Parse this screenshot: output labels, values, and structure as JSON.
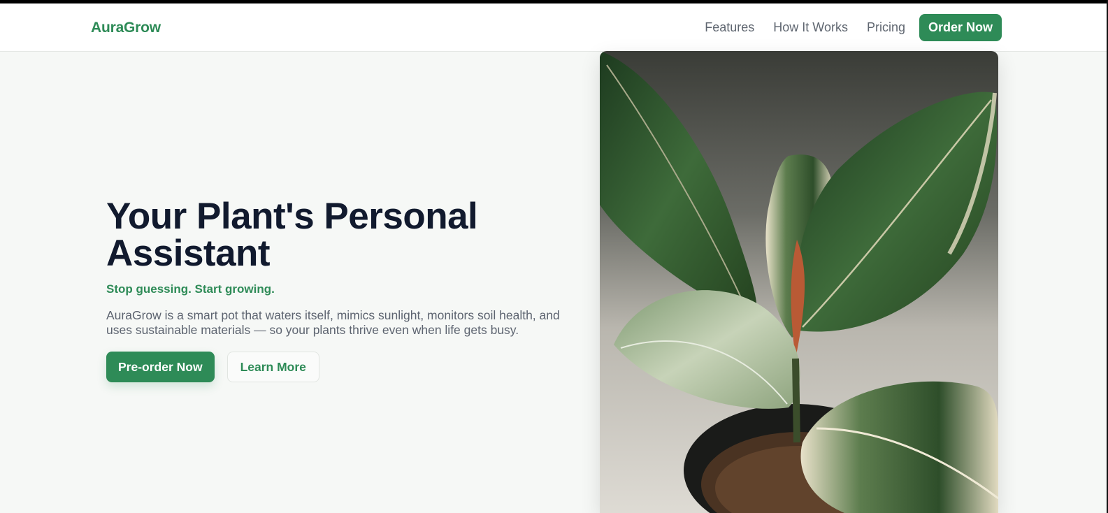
{
  "brand": {
    "name": "AuraGrow"
  },
  "nav": {
    "links": [
      "Features",
      "How It Works",
      "Pricing"
    ],
    "cta_label": "Order Now"
  },
  "hero": {
    "title_line1": "Your Plant's Personal",
    "title_line2": "Assistant",
    "tagline": "Stop guessing. Start growing.",
    "description": "AuraGrow is a smart pot that waters itself, mimics sunlight, monitors soil health, and uses sustainable materials — so your plants thrive even when life gets busy.",
    "primary_button": "Pre-order Now",
    "secondary_button": "Learn More",
    "image_subject": "potted-rubber-plant-photo"
  },
  "colors": {
    "brand_green": "#2e8b57",
    "heading": "#111a2e",
    "body_text": "#5d6470",
    "background": "#f6f8f6"
  }
}
